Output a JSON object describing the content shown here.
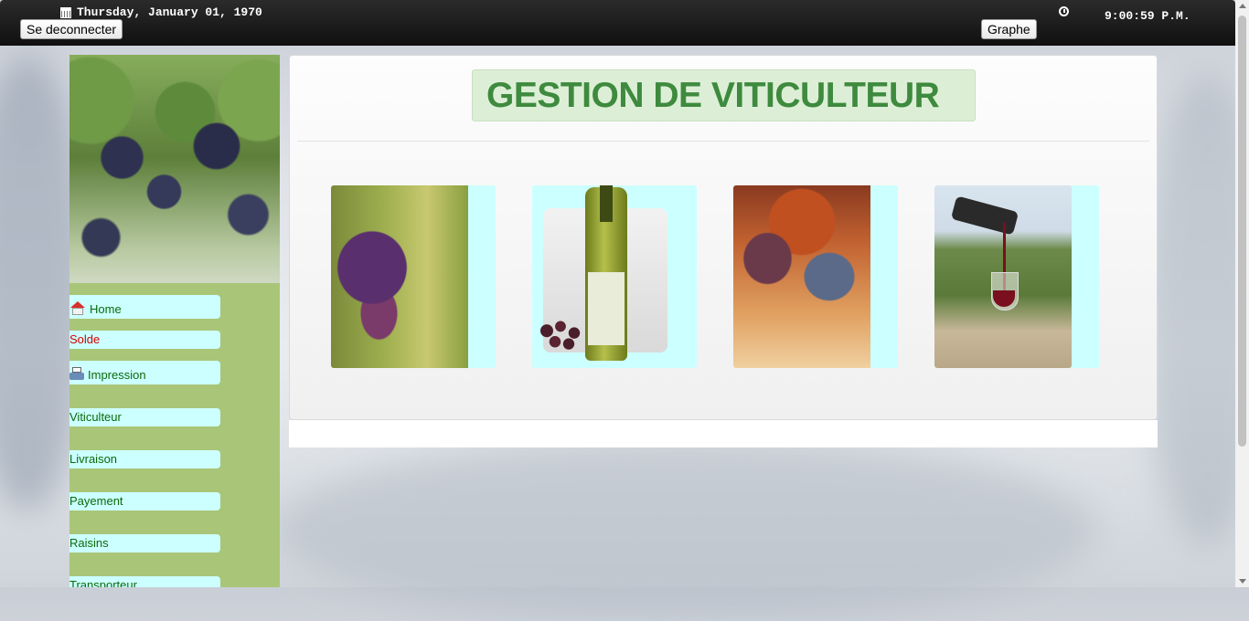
{
  "header": {
    "date": "Thursday, January 01, 1970",
    "time": "9:00:59 P.M.",
    "logout_label": "Se deconnecter",
    "graph_label": "Graphe"
  },
  "sidebar": {
    "items": [
      {
        "label": "Home",
        "icon": "home-icon"
      },
      {
        "label": "Solde"
      },
      {
        "label": "Impression",
        "icon": "printer-icon"
      },
      {
        "label": "Viticulteur"
      },
      {
        "label": "Livraison"
      },
      {
        "label": "Payement"
      },
      {
        "label": "Raisins"
      },
      {
        "label": "Transporteur"
      }
    ]
  },
  "main": {
    "title": "GESTION DE VITICULTEUR"
  },
  "colors": {
    "sidebar_bg": "#a9c578",
    "nav_item_bg": "#ccffff",
    "nav_text": "#0a6a0a",
    "nav_text_alert": "#d40000",
    "title_text": "#3e8a3e",
    "title_bg": "#dcefd6"
  }
}
